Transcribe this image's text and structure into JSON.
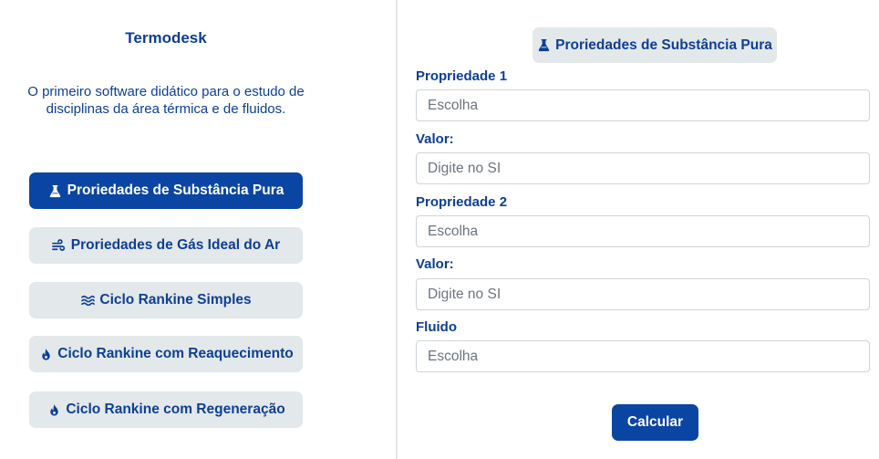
{
  "app": {
    "title": "Termodesk",
    "tagline": "O primeiro software didático para o estudo de disciplinas da área térmica e de fluidos."
  },
  "nav": {
    "items": [
      {
        "label": "Proriedades de Substância Pura",
        "icon": "flask-icon",
        "active": true
      },
      {
        "label": "Proriedades de Gás Ideal do Ar",
        "icon": "wind-icon",
        "active": false
      },
      {
        "label": "Ciclo Rankine Simples",
        "icon": "water-icon",
        "active": false
      },
      {
        "label": "Ciclo Rankine com Reaquecimento",
        "icon": "fire-icon",
        "active": false
      },
      {
        "label": "Ciclo Rankine com Regeneração",
        "icon": "fire-icon",
        "active": false
      }
    ]
  },
  "form": {
    "section_title": "Proriedades de Substância Pura",
    "section_icon": "flask-icon",
    "fields": [
      {
        "label": "Propriedade 1",
        "placeholder": "Escolha",
        "value": ""
      },
      {
        "label": "Valor:",
        "placeholder": "Digite no SI",
        "value": ""
      },
      {
        "label": "Propriedade 2",
        "placeholder": "Escolha",
        "value": ""
      },
      {
        "label": "Valor:",
        "placeholder": "Digite no SI",
        "value": ""
      },
      {
        "label": "Fluido",
        "placeholder": "Escolha",
        "value": ""
      }
    ],
    "submit_label": "Calcular"
  },
  "colors": {
    "primary": "#0b45a3",
    "text": "#0d3f95",
    "button_bg": "#e3e8ea",
    "divider": "#e4e6e8"
  }
}
